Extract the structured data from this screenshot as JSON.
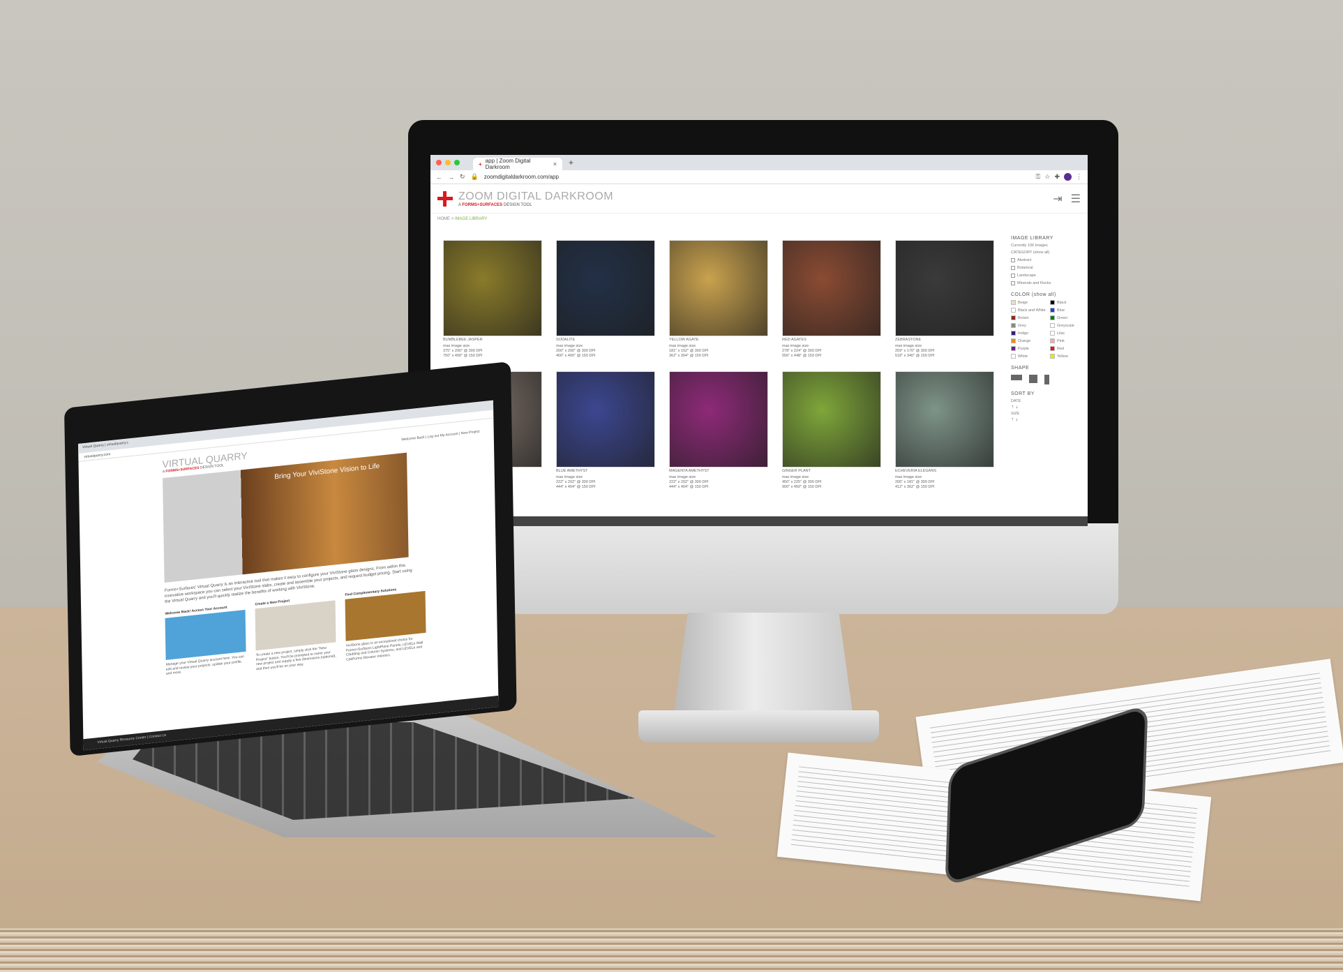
{
  "imac": {
    "tab_title": "app | Zoom Digital Darkroom",
    "tab_close": "×",
    "new_tab": "+",
    "url": "zoomdigitaldarkroom.com/app",
    "brand_title": "ZOOM DIGITAL DARKROOM",
    "brand_sub_prefix": "A",
    "brand_sub_company": "FORMS+SURFACES",
    "brand_sub_suffix": "DESIGN TOOL",
    "breadcrumb_home": "HOME",
    "breadcrumb_sep": ">",
    "breadcrumb_current": "IMAGE LIBRARY",
    "images": [
      {
        "name": "BUMBLEBEE JASPER",
        "caption": "max image size\n375\" x 200\" @ 300 DPI\n750\" x 400\" @ 150 DPI",
        "color": "#8a7b2a"
      },
      {
        "name": "SODALITE",
        "caption": "max image size\n200\" x 200\" @ 300 DPI\n400\" x 400\" @ 150 DPI",
        "color": "#223046"
      },
      {
        "name": "YELLOW AGATE",
        "caption": "max image size\n181\" x 152\" @ 300 DPI\n362\" x 304\" @ 150 DPI",
        "color": "#c9a24e"
      },
      {
        "name": "RED AGATES",
        "caption": "max image size\n278\" x 224\" @ 300 DPI\n556\" x 448\" @ 150 DPI",
        "color": "#8a4b33"
      },
      {
        "name": "ZEBRASTONE",
        "caption": "max image size\n259\" x 170\" @ 300 DPI\n518\" x 340\" @ 150 DPI",
        "color": "#3a3a3a"
      },
      {
        "name": "",
        "caption": "",
        "color": "#7a6e66"
      },
      {
        "name": "BLUE AMETHYST",
        "caption": "max image size\n222\" x 202\" @ 300 DPI\n444\" x 404\" @ 150 DPI",
        "color": "#3c4790"
      },
      {
        "name": "MAGENTA AMETHYST",
        "caption": "max image size\n222\" x 202\" @ 300 DPI\n444\" x 404\" @ 150 DPI",
        "color": "#8e2a78"
      },
      {
        "name": "GINGER PLANT",
        "caption": "max image size\n450\" x 225\" @ 300 DPI\n900\" x 450\" @ 150 DPI",
        "color": "#7fa63a"
      },
      {
        "name": "ECHEVERIA ELEGANS",
        "caption": "max image size\n206\" x 181\" @ 300 DPI\n412\" x 362\" @ 150 DPI",
        "color": "#7e9488"
      }
    ],
    "sidebar": {
      "title": "IMAGE LIBRARY",
      "count": "Currently 106 Images",
      "category_label": "CATEGORY (show all)",
      "categories": [
        "Abstract",
        "Botanical",
        "Landscape",
        "Minerals and Rocks"
      ],
      "color_label": "COLOR (show all)",
      "colors": [
        {
          "name": "Beige",
          "hex": "#e8dfc4"
        },
        {
          "name": "Black",
          "hex": "#000000"
        },
        {
          "name": "Black and White",
          "hex": "#ffffff"
        },
        {
          "name": "Blue",
          "hex": "#1f3fd6"
        },
        {
          "name": "Brown",
          "hex": "#8b2a22"
        },
        {
          "name": "Green",
          "hex": "#0a7a1a"
        },
        {
          "name": "Grey",
          "hex": "#888888"
        },
        {
          "name": "Greyscale",
          "hex": "#ffffff"
        },
        {
          "name": "Indigo",
          "hex": "#3a1c7a"
        },
        {
          "name": "Lilac",
          "hex": "#ffffff"
        },
        {
          "name": "Orange",
          "hex": "#f28c00"
        },
        {
          "name": "Pink",
          "hex": "#f4a7b9"
        },
        {
          "name": "Purple",
          "hex": "#6b1f8a"
        },
        {
          "name": "Red",
          "hex": "#d71920"
        },
        {
          "name": "White",
          "hex": "#ffffff"
        },
        {
          "name": "Yellow",
          "hex": "#f5e400"
        }
      ],
      "shape_label": "SHAPE",
      "sort_label": "SORT BY",
      "sort_date": "DATE",
      "sort_size": "SIZE"
    }
  },
  "laptop": {
    "tab_title": "Virtual Quarry | virtualquarry.c",
    "url": "virtualquarry.com",
    "title": "VIRTUAL QUARRY",
    "sub_prefix": "A",
    "sub_company": "FORMS+SURFACES",
    "sub_suffix": "DESIGN TOOL",
    "welcome": "Welcome Back | Log out My Account | New Project",
    "hero_text": "Bring Your ViviStone Vision to Life",
    "intro": "Forms+Surfaces' Virtual Quarry is an interactive tool that makes it easy to configure your ViviStone glass designs. From within this innovative workspace you can select your ViviStone slabs, create and assemble your projects, and request budget pricing. Start using the Virtual Quarry and you'll quickly realize the benefits of working with ViviStone.",
    "cols": [
      {
        "heading": "Welcome Back! Access Your Account",
        "text": "Manage your Virtual Quarry account here. You can edit and review your projects, update your profile, and more.",
        "color": "#4fa3d9"
      },
      {
        "heading": "Create a New Project",
        "text": "To create a new project, simply click the \"New Project\" button. You'll be prompted to name your new project and supply a few dimensions (optional), and then you'll be on your way.",
        "color": "#d9d2c6"
      },
      {
        "heading": "Find Complementary Solutions",
        "text": "ViviStone glass is an exceptional choice for Forms+Surfaces LightPlane Panels, LEVELe Wall Cladding and Column Systems, and LEVELe and CabForms Elevator Interiors.",
        "color": "#a8762f"
      }
    ],
    "footer": "Virtual Quarry Resource Center | Contact Us"
  }
}
